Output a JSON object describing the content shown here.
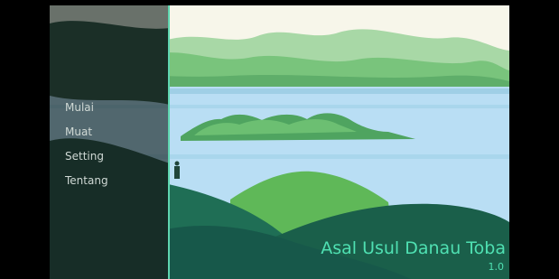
{
  "game": {
    "title": "Asal Usul Danau Toba",
    "version": "1.0"
  },
  "menu": {
    "items": [
      {
        "label": "Mulai"
      },
      {
        "label": "Muat"
      },
      {
        "label": "Setting"
      },
      {
        "label": "Tentang"
      }
    ]
  },
  "colors": {
    "accent": "#4fe0b2",
    "sky": "#f7f6ea",
    "lake": "#b9def4",
    "hill_light": "#79c47c",
    "hill_dark": "#1f6e55"
  }
}
